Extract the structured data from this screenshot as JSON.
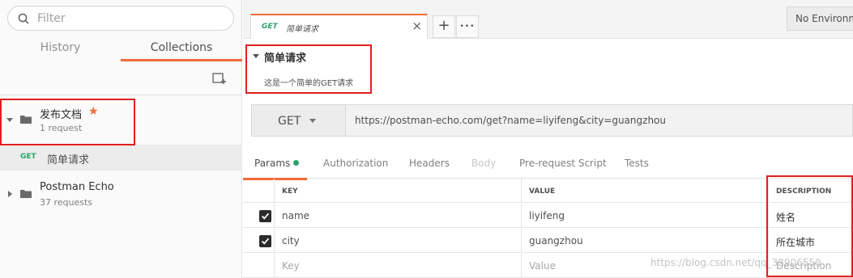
{
  "sidebar": {
    "filter_placeholder": "Filter",
    "tabs": {
      "history": "History",
      "collections": "Collections"
    },
    "collections": [
      {
        "name": "发布文档",
        "count": "1 request",
        "starred": true
      },
      {
        "name": "Postman Echo",
        "count": "37 requests",
        "starred": false
      }
    ],
    "request": {
      "method": "GET",
      "name": "简单请求"
    }
  },
  "topbar": {
    "tab": {
      "method": "GET",
      "name": "简单请求",
      "close": "×"
    },
    "add": "+",
    "more": "•••",
    "environment": "No Environment"
  },
  "request": {
    "title": "简单请求",
    "description": "这是一个简单的GET请求",
    "method": "GET",
    "url": "https://postman-echo.com/get?name=liyifeng&city=guangzhou"
  },
  "request_tabs": [
    "Params",
    "Authorization",
    "Headers",
    "Body",
    "Pre-request Script",
    "Tests"
  ],
  "params": {
    "headers": {
      "key": "KEY",
      "value": "VALUE",
      "description": "DESCRIPTION"
    },
    "rows": [
      {
        "key": "name",
        "value": "liyifeng",
        "description": "姓名",
        "checked": true
      },
      {
        "key": "city",
        "value": "guangzhou",
        "description": "所在城市",
        "checked": true
      }
    ],
    "new_row": {
      "key": "Key",
      "value": "Value",
      "description": "Description"
    }
  },
  "watermark": "https://blog.csdn.net/qq_38906550",
  "colors": {
    "accent": "#f26b3a",
    "get_method": "#2aa36b",
    "highlight_box": "#e02020"
  }
}
